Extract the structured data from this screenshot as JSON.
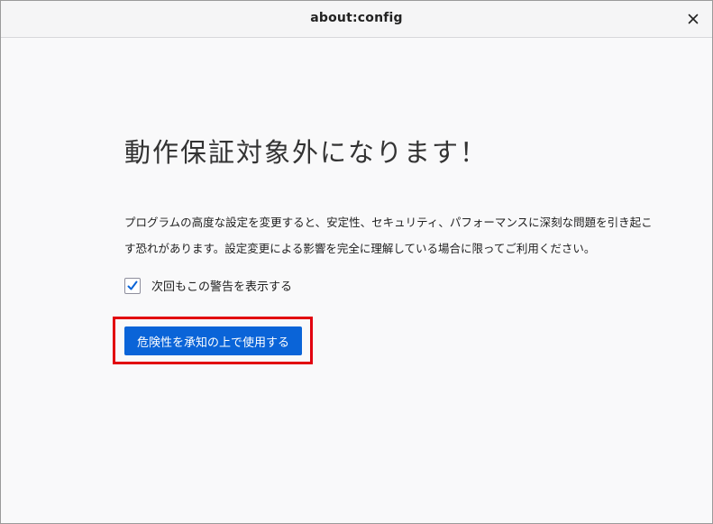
{
  "window": {
    "title": "about:config",
    "close_label": "×"
  },
  "warning": {
    "heading": "動作保証対象外になります！",
    "body": "プログラムの高度な設定を変更すると、安定性、セキュリティ、パフォーマンスに深刻な問題を引き起こす恐れがあります。設定変更による影響を完全に理解している場合に限ってご利用ください。",
    "checkbox_label": "次回もこの警告を表示する",
    "checkbox_checked": true,
    "accept_button_label": "危険性を承知の上で使用する"
  },
  "colors": {
    "accent_button": "#0a64d8",
    "highlight_border": "#e2000f",
    "checkmark": "#0a64d8"
  }
}
